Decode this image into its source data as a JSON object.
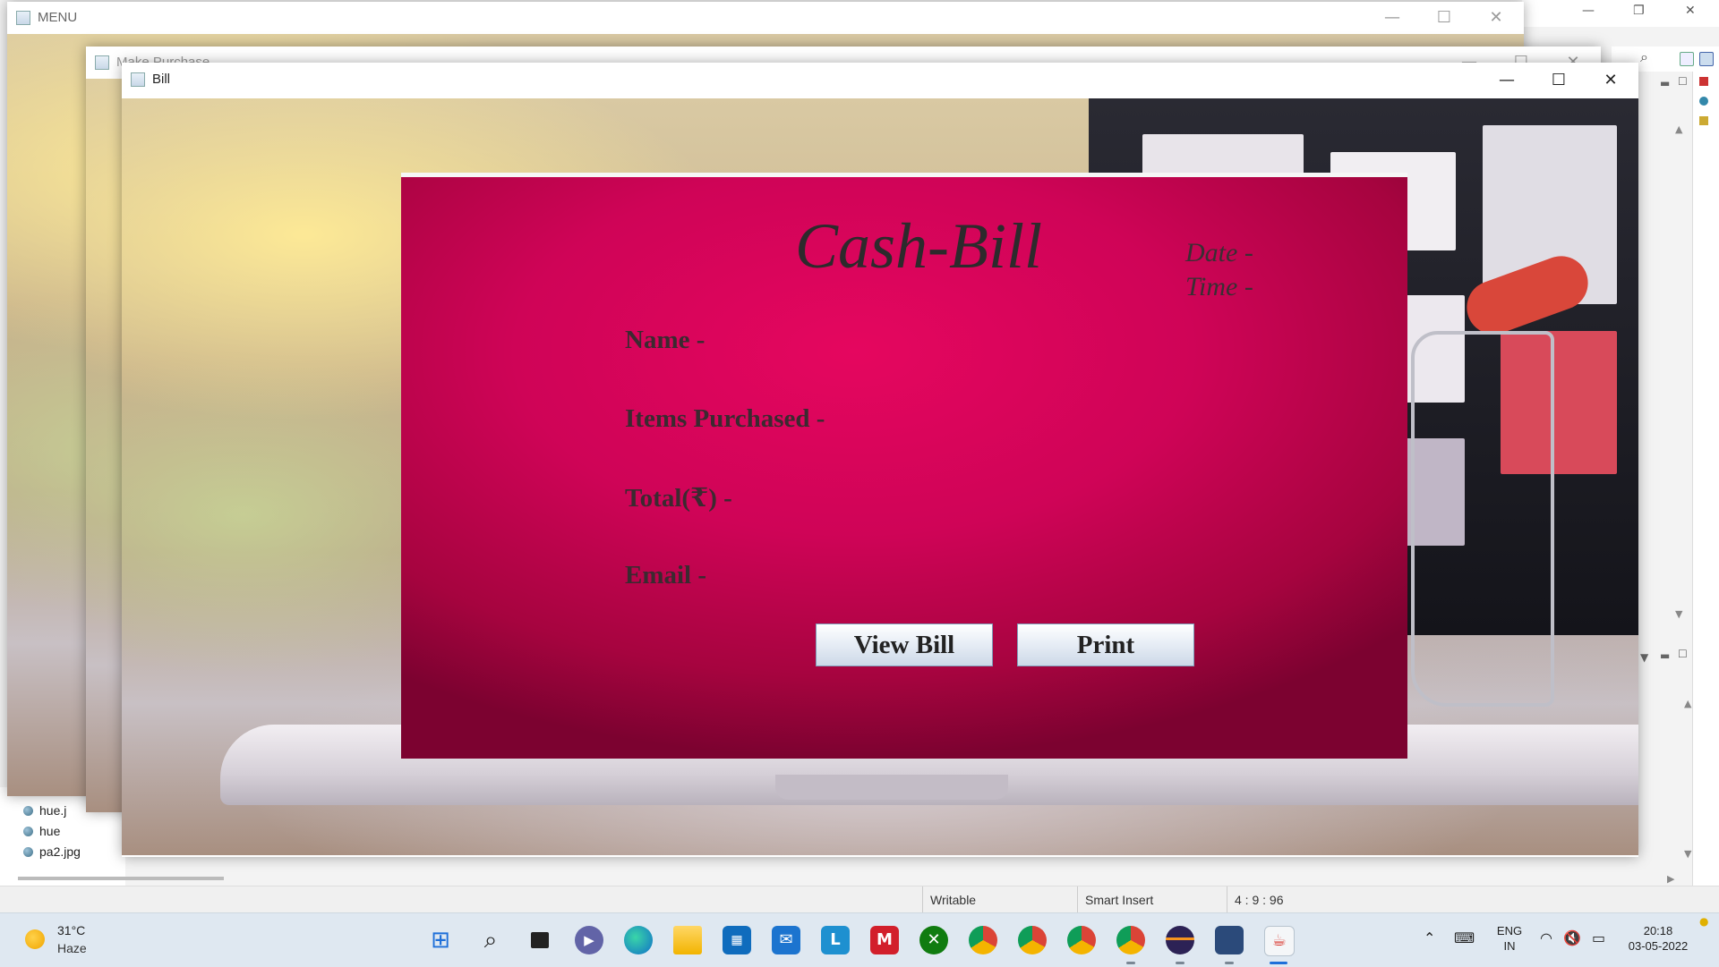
{
  "windows": {
    "menu": {
      "title": "MENU"
    },
    "make_purchase": {
      "title": "Make Purchase"
    },
    "bill": {
      "title": "Bill"
    }
  },
  "window_controls": {
    "minimize": "—",
    "maximize": "☐",
    "close": "✕"
  },
  "bill_card": {
    "title": "Cash-Bill",
    "date_label": "Date -",
    "time_label": "Time -",
    "fields": {
      "name": "Name -",
      "items": "Items Purchased -",
      "total": "Total(₹) -",
      "email": "Email -"
    },
    "buttons": {
      "view_bill": "View Bill",
      "print": "Print"
    },
    "colors": {
      "card_center": "#e5065f",
      "card_edge": "#7c0230"
    }
  },
  "ide": {
    "package_items": [
      "hue.j",
      "hue",
      "pa2.jpg"
    ],
    "status": {
      "mode": "Writable",
      "insert": "Smart Insert",
      "position": "4 : 9 : 96"
    }
  },
  "taskbar": {
    "weather": {
      "temp": "31°C",
      "desc": "Haze"
    },
    "apps": [
      "start-icon",
      "search-icon",
      "task-view-icon",
      "chat-icon",
      "edge-icon",
      "file-explorer-icon",
      "store-icon",
      "mail-icon",
      "l-app-icon",
      "mcafee-icon",
      "xbox-icon",
      "chrome-icon",
      "chrome-profile2-icon",
      "chrome-profile3-icon",
      "chrome-profile4-icon",
      "eclipse-icon",
      "app-icon",
      "java-icon"
    ],
    "tray": {
      "language_top": "ENG",
      "language_bottom": "IN",
      "time": "20:18",
      "date": "03-05-2022"
    }
  }
}
